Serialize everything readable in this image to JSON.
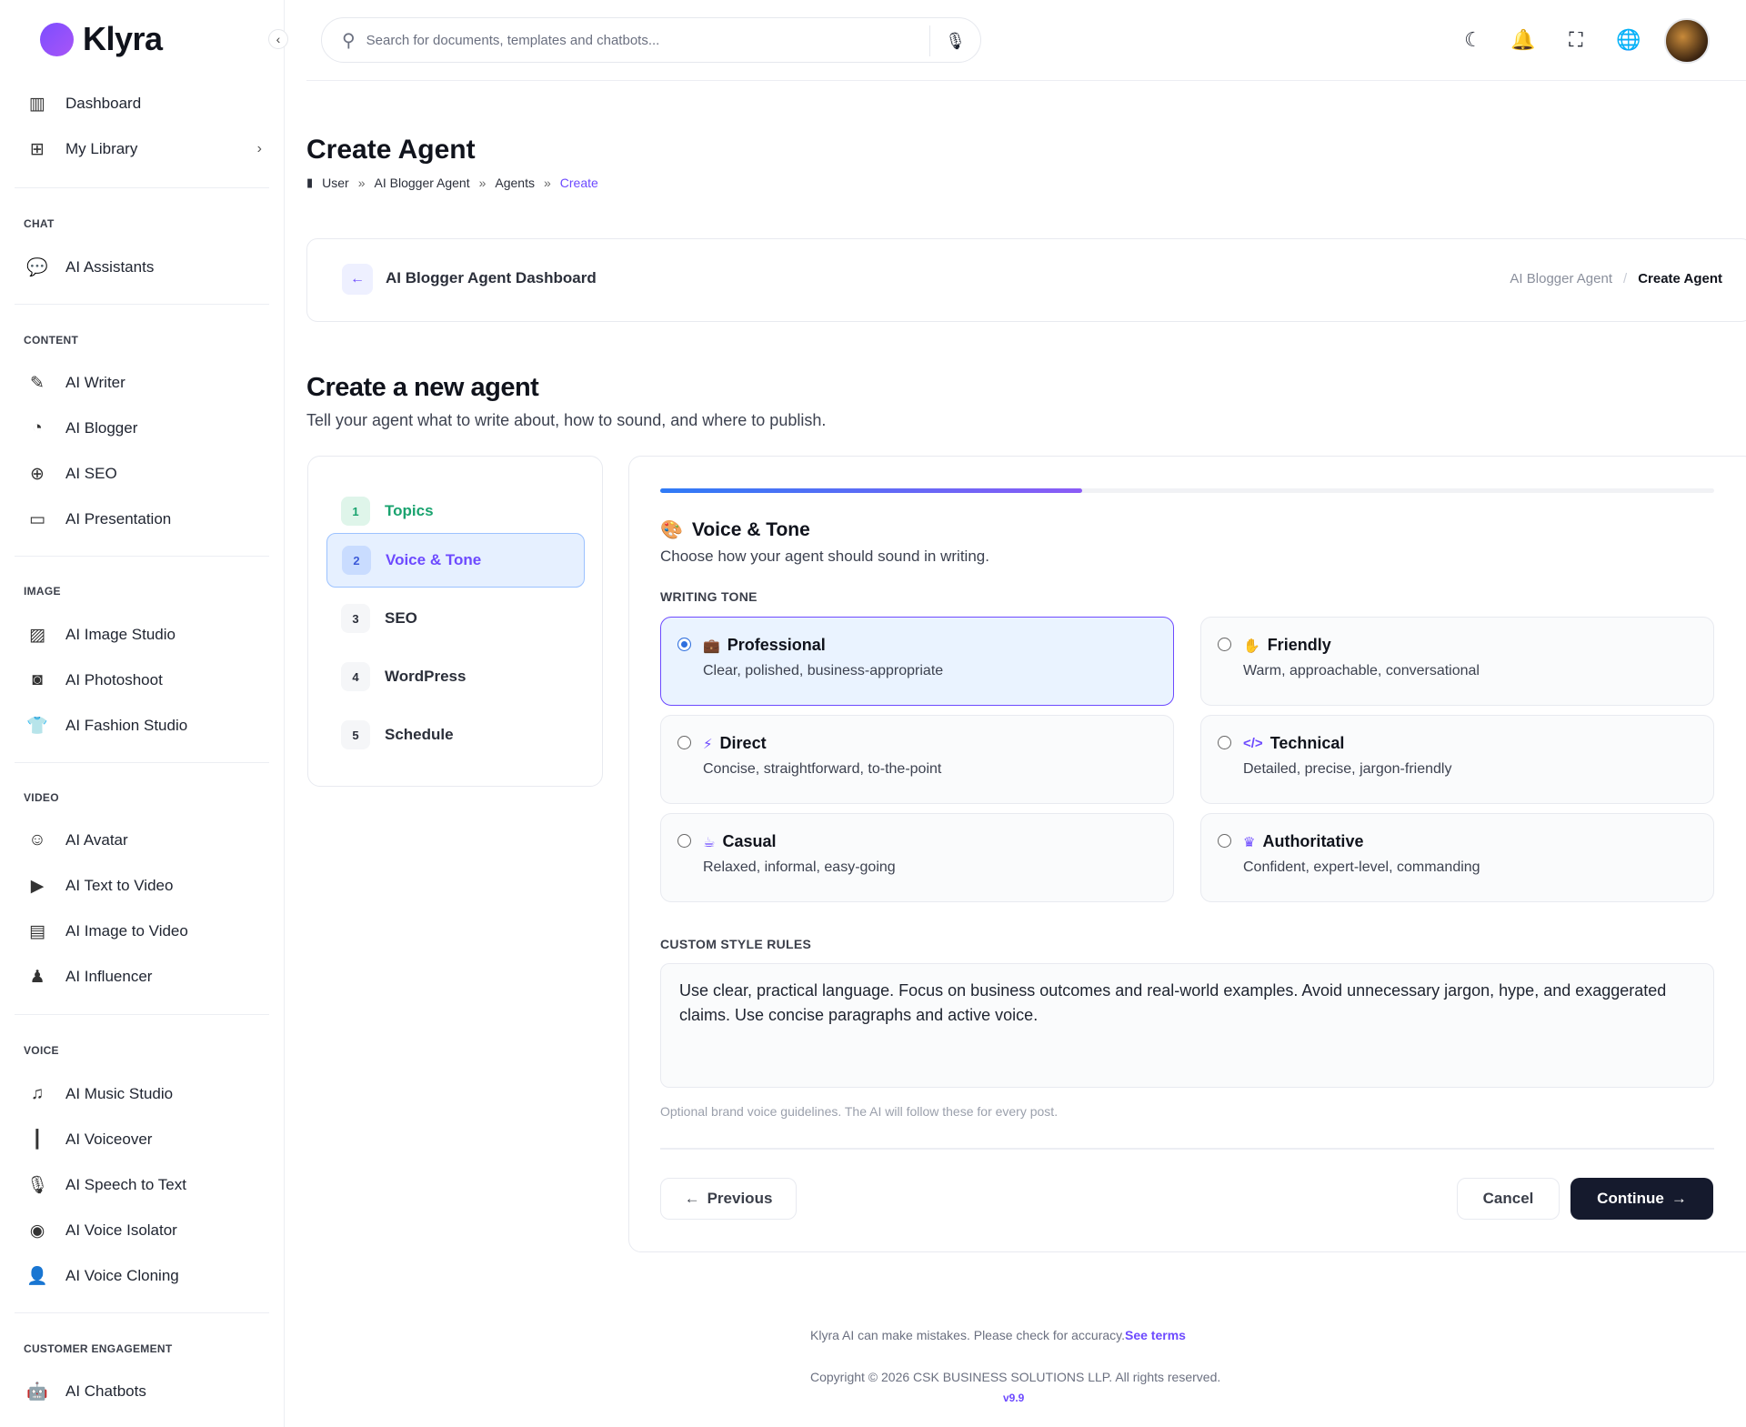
{
  "app": {
    "name": "Klyra"
  },
  "sidebar": {
    "top": [
      {
        "label": "Dashboard",
        "icon": "map-icon"
      },
      {
        "label": "My Library",
        "icon": "folder-plus-icon"
      }
    ],
    "sections": [
      {
        "title": "CHAT",
        "items": [
          {
            "label": "AI Assistants",
            "icon": "chat-icon"
          }
        ]
      },
      {
        "title": "CONTENT",
        "items": [
          {
            "label": "AI Writer",
            "icon": "pen-icon"
          },
          {
            "label": "AI Blogger",
            "icon": "rss-icon"
          },
          {
            "label": "AI SEO",
            "icon": "globe-icon"
          },
          {
            "label": "AI Presentation",
            "icon": "presentation-icon"
          }
        ]
      },
      {
        "title": "IMAGE",
        "items": [
          {
            "label": "AI Image Studio",
            "icon": "images-icon"
          },
          {
            "label": "AI Photoshoot",
            "icon": "camera-icon"
          },
          {
            "label": "AI Fashion Studio",
            "icon": "shirt-icon"
          }
        ]
      },
      {
        "title": "VIDEO",
        "items": [
          {
            "label": "AI Avatar",
            "icon": "masks-icon"
          },
          {
            "label": "AI Text to Video",
            "icon": "video-plus-icon"
          },
          {
            "label": "AI Image to Video",
            "icon": "file-video-icon"
          },
          {
            "label": "AI Influencer",
            "icon": "user-secret-icon"
          }
        ]
      },
      {
        "title": "VOICE",
        "items": [
          {
            "label": "AI Music Studio",
            "icon": "music-icon"
          },
          {
            "label": "AI Voiceover",
            "icon": "waveform-icon"
          },
          {
            "label": "AI Speech to Text",
            "icon": "microphone-icon"
          },
          {
            "label": "AI Voice Isolator",
            "icon": "target-icon"
          },
          {
            "label": "AI Voice Cloning",
            "icon": "user-voice-icon"
          }
        ]
      },
      {
        "title": "CUSTOMER ENGAGEMENT",
        "items": [
          {
            "label": "AI Chatbots",
            "icon": "robot-icon"
          }
        ]
      }
    ]
  },
  "search": {
    "placeholder": "Search for documents, templates and chatbots..."
  },
  "page": {
    "title": "Create Agent",
    "breadcrumb": [
      "User",
      "AI Blogger Agent",
      "Agents",
      "Create"
    ]
  },
  "header_card": {
    "title": "AI Blogger Agent Dashboard",
    "crumb_parent": "AI Blogger Agent",
    "crumb_sep": "/",
    "crumb_current": "Create Agent"
  },
  "intro": {
    "title": "Create a new agent",
    "subtitle": "Tell your agent what to write about, how to sound, and where to publish."
  },
  "steps": [
    {
      "num": "1",
      "label": "Topics",
      "state": "done"
    },
    {
      "num": "2",
      "label": "Voice & Tone",
      "state": "active"
    },
    {
      "num": "3",
      "label": "SEO",
      "state": "pending"
    },
    {
      "num": "4",
      "label": "WordPress",
      "state": "pending"
    },
    {
      "num": "5",
      "label": "Schedule",
      "state": "pending"
    }
  ],
  "form": {
    "progress_fraction": 0.4,
    "section_title": "Voice & Tone",
    "section_icon": "palette-icon",
    "section_subtitle": "Choose how your agent should sound in writing.",
    "tone_label": "WRITING TONE",
    "tones": [
      {
        "title": "Professional",
        "desc": "Clear, polished, business-appropriate",
        "icon": "briefcase-icon",
        "selected": true
      },
      {
        "title": "Friendly",
        "desc": "Warm, approachable, conversational",
        "icon": "hand-wave-icon",
        "selected": false
      },
      {
        "title": "Direct",
        "desc": "Concise, straightforward, to-the-point",
        "icon": "bolt-icon",
        "selected": false
      },
      {
        "title": "Technical",
        "desc": "Detailed, precise, jargon-friendly",
        "icon": "code-icon",
        "selected": false
      },
      {
        "title": "Casual",
        "desc": "Relaxed, informal, easy-going",
        "icon": "coffee-icon",
        "selected": false
      },
      {
        "title": "Authoritative",
        "desc": "Confident, expert-level, commanding",
        "icon": "crown-icon",
        "selected": false
      }
    ],
    "rules_label": "CUSTOM STYLE RULES",
    "rules_value": "Use clear, practical language. Focus on business outcomes and real-world examples. Avoid unnecessary jargon, hype, and exaggerated claims. Use concise paragraphs and active voice.",
    "rules_hint": "Optional brand voice guidelines. The AI will follow these for every post.",
    "buttons": {
      "previous": "Previous",
      "cancel": "Cancel",
      "continue": "Continue"
    }
  },
  "footer": {
    "disclaimer": "Klyra AI can make mistakes. Please check for accuracy.",
    "terms_link": "See terms",
    "copyright": "Copyright © 2026 CSK BUSINESS SOLUTIONS LLP. All rights reserved.",
    "version": "v9.9"
  },
  "colors": {
    "accent": "#6d4aff",
    "success": "#1aa36f",
    "primary_button": "#151a2d"
  }
}
